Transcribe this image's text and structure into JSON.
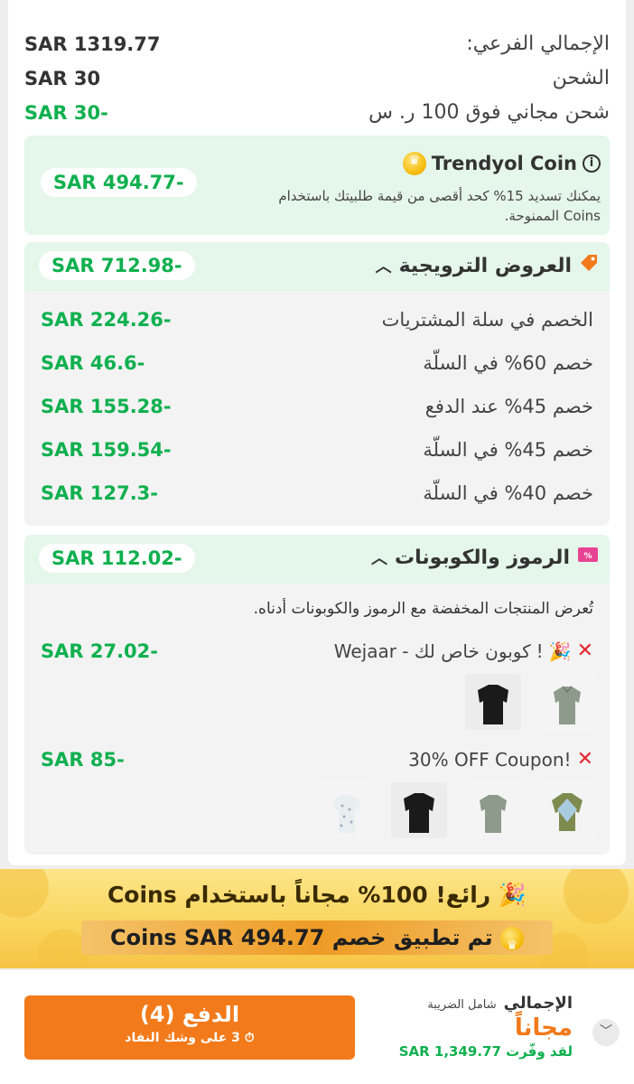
{
  "summary": {
    "subtotal_label": "الإجمالي الفرعي:",
    "subtotal_value": "SAR 1319.77",
    "shipping_label": "الشحن",
    "shipping_value": "SAR 30",
    "free_shipping_label": "شحن مجاني فوق 100 ر. س",
    "free_shipping_value": "-SAR 30"
  },
  "coins": {
    "title": "Trendyol Coin",
    "description_line1": "يمكنك تسديد 15% كحد أقصى من قيمة طلبيتك باستخدام",
    "description_line2": "Coins الممنوحة.",
    "value": "-SAR 494.77"
  },
  "promotions": {
    "title": "العروض الترويجية",
    "total": "-SAR 712.98",
    "items": [
      {
        "label": "الخصم في سلة المشتريات",
        "value": "-SAR 224.26"
      },
      {
        "label": "خصم 60% في السلّة",
        "value": "-SAR 46.6"
      },
      {
        "label": "خصم 45% عند الدفع",
        "value": "-SAR 155.28"
      },
      {
        "label": "خصم 45% في السلّة",
        "value": "-SAR 159.54"
      },
      {
        "label": "خصم 40% في السلّة",
        "value": "-SAR 127.3"
      }
    ]
  },
  "codes": {
    "title": "الرموز والكوبونات",
    "total": "-SAR 112.02",
    "note": "تُعرض المنتجات المخفضة مع الرموز والكوبونات أدناه.",
    "coupons": [
      {
        "label": "كوبون خاص لك - Wejaar",
        "prefix": "!",
        "value": "-SAR 27.02"
      },
      {
        "label": "30% OFF Coupon!",
        "value": "-SAR 85"
      }
    ]
  },
  "banner": {
    "title": "رائع! 100% مجاناً باستخدام Coins",
    "bar": "تم تطبيق خصم Coins SAR 494.77"
  },
  "footer": {
    "total_label": "الإجمالي",
    "tax_note": "شامل الضريبة",
    "total_value": "مجاناً",
    "saved": "لقد وفّرت SAR 1,349.77",
    "pay_label": "الدفع (4)",
    "stock_note": "3 على وشك النفاد"
  },
  "colors": {
    "accent_orange": "#f27a1a",
    "discount_green": "#10b04f",
    "light_green_bg": "#e5f6eb",
    "remove_red": "#e3272f"
  }
}
